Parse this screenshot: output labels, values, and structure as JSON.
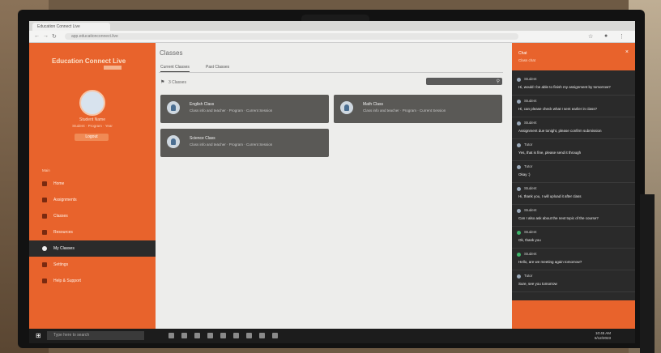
{
  "browser": {
    "tab_title": "Education Connect Live",
    "url": "app.educationconnect.live",
    "nav_icons": [
      "back-icon",
      "forward-icon",
      "reload-icon"
    ],
    "right_icons": [
      "star-icon",
      "profile-icon",
      "menu-icon"
    ]
  },
  "sidebar": {
    "brand_main": "Education",
    "brand_accent": "Connect Live",
    "profile_name": "Student Name",
    "profile_sub": "Student · Program · Year",
    "profile_button": "Logout",
    "section_label": "Main",
    "items": [
      {
        "label": "Home",
        "icon": "home-icon",
        "active": false
      },
      {
        "label": "Assignments",
        "icon": "assignment-icon",
        "active": false
      },
      {
        "label": "Classes",
        "icon": "class-icon",
        "active": false
      },
      {
        "label": "Resources",
        "icon": "resource-icon",
        "active": false
      },
      {
        "label": "My Classes",
        "icon": "classes-icon",
        "active": true
      },
      {
        "label": "Settings",
        "icon": "gear-icon",
        "active": false
      },
      {
        "label": "Help & Support",
        "icon": "help-icon",
        "active": false
      }
    ]
  },
  "main": {
    "title": "Classes",
    "tabs": [
      {
        "label": "Current Classes",
        "active": true
      },
      {
        "label": "Past Classes",
        "active": false
      }
    ],
    "row_label": "3 Classes",
    "cards": [
      {
        "title": "English Class",
        "subtitle": "Class info and teacher · Program · Current Session"
      },
      {
        "title": "Math Class",
        "subtitle": "Class info and teacher · Program · Current Session"
      },
      {
        "title": "Science Class",
        "subtitle": "Class info and teacher · Program · Current Session"
      }
    ]
  },
  "chat": {
    "title": "Chat",
    "subtitle": "Class chat",
    "messages": [
      {
        "who": "Student",
        "text": "Hi, would I be able to finish my assignment by tomorrow?",
        "online": false
      },
      {
        "who": "Student",
        "text": "Hi, can please check what I sent earlier in class?",
        "online": false
      },
      {
        "who": "Student",
        "text": "Assignment due tonight, please confirm submission",
        "online": false
      },
      {
        "who": "Tutor",
        "text": "Yes, that is fine, please send it through",
        "online": false
      },
      {
        "who": "Tutor",
        "text": "Okay :)",
        "online": false
      },
      {
        "who": "Student",
        "text": "Hi, thank you, I will upload it after class",
        "online": false
      },
      {
        "who": "Student",
        "text": "Can I also ask about the next topic of the course?",
        "online": false
      },
      {
        "who": "Student",
        "text": "Ok, thank you",
        "online": true
      },
      {
        "who": "Student",
        "text": "Hello, are we meeting again tomorrow?",
        "online": true
      },
      {
        "who": "Tutor",
        "text": "Sure, see you tomorrow",
        "online": false
      }
    ]
  },
  "taskbar": {
    "search_placeholder": "Type here to search",
    "time": "10:45 AM",
    "date": "6/12/2023"
  }
}
